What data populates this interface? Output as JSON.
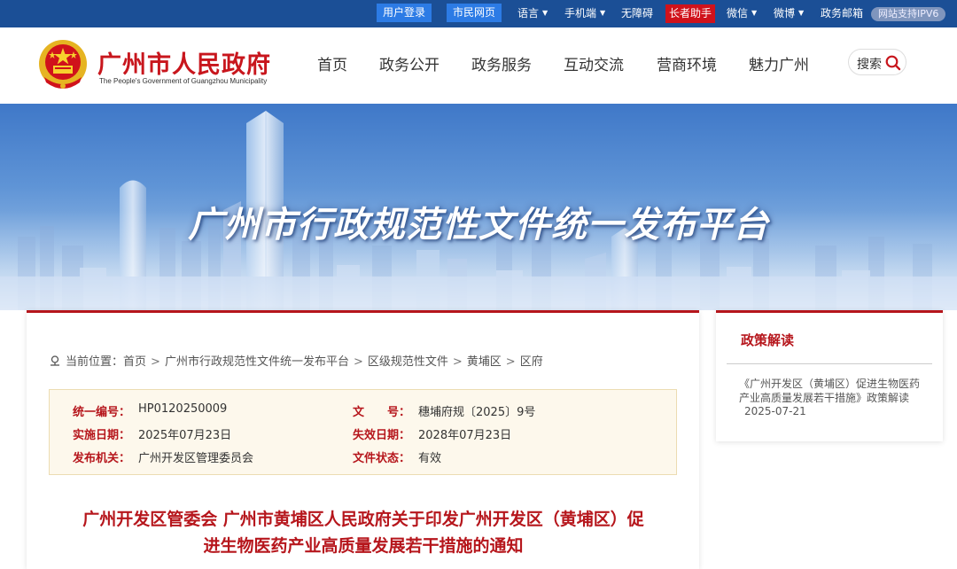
{
  "topbar": {
    "login": "用户登录",
    "citizen": "市民网页",
    "language": "语言",
    "mobile": "手机端",
    "accessibility": "无障碍",
    "elder": "长者助手",
    "wechat": "微信",
    "weibo": "微博",
    "mail": "政务邮箱",
    "ipv6": "网站支持IPV6"
  },
  "header": {
    "site_name": "广州市人民政府",
    "site_name_en": "The People's Government of Guangzhou Municipality",
    "nav": [
      "首页",
      "政务公开",
      "政务服务",
      "互动交流",
      "营商环境",
      "魅力广州"
    ],
    "search_label": "搜索"
  },
  "banner": {
    "title": "广州市行政规范性文件统一发布平台"
  },
  "breadcrumb": {
    "label": "当前位置：",
    "items": [
      "首页",
      "广州市行政规范性文件统一发布平台",
      "区级规范性文件",
      "黄埔区",
      "区府"
    ]
  },
  "info": {
    "serial_label": "统一编号：",
    "serial": "HP0120250009",
    "docno_label": "文　　号：",
    "docno": "穗埔府规〔2025〕9号",
    "effective_label": "实施日期：",
    "effective": "2025年07月23日",
    "expire_label": "失效日期：",
    "expire": "2028年07月23日",
    "issuer_label": "发布机关：",
    "issuer": "广州开发区管理委员会",
    "status_label": "文件状态：",
    "status": "有效"
  },
  "document": {
    "title": "广州开发区管委会 广州市黄埔区人民政府关于印发广州开发区（黄埔区）促进生物医药产业高质量发展若干措施的通知"
  },
  "sidebar": {
    "title": "政策解读",
    "link": "《广州开发区（黄埔区）促进生物医药产业高质量发展若干措施》政策解读",
    "date": "2025-07-21"
  },
  "colors": {
    "topbar": "#1b4f96",
    "accent_red": "#b6161c",
    "button_blue": "#2c7be5"
  }
}
